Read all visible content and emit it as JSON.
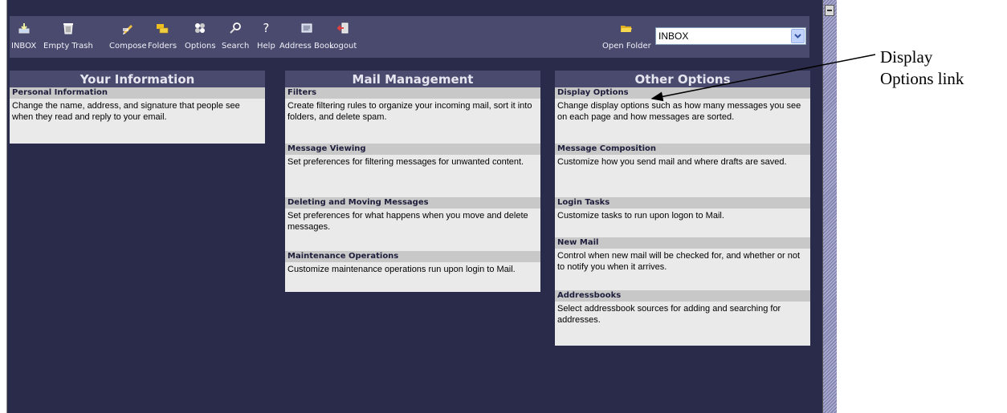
{
  "toolbar": {
    "items": [
      {
        "label": "INBOX",
        "icon": "inbox-tray-icon"
      },
      {
        "label": "Empty Trash",
        "icon": "trash-can-icon"
      },
      {
        "label": "Compose",
        "icon": "pencil-icon"
      },
      {
        "label": "Folders",
        "icon": "folders-icon"
      },
      {
        "label": "Options",
        "icon": "options-icon"
      },
      {
        "label": "Search",
        "icon": "magnifier-icon"
      },
      {
        "label": "Help",
        "icon": "question-mark-icon"
      },
      {
        "label": "Address Book",
        "icon": "address-book-icon"
      },
      {
        "label": "Logout",
        "icon": "logout-icon"
      }
    ],
    "open_folder_label": "Open Folder",
    "folder_select_value": "INBOX"
  },
  "columns": [
    {
      "heading": "Your Information",
      "sections": [
        {
          "title": "Personal Information",
          "desc": "Change the name, address, and signature that people see when they read and reply to your email."
        }
      ]
    },
    {
      "heading": "Mail Management",
      "sections": [
        {
          "title": "Filters",
          "desc": "Create filtering rules to organize your incoming mail, sort it into folders, and delete spam."
        },
        {
          "title": "Message Viewing",
          "desc": "Set preferences for filtering messages for unwanted content."
        },
        {
          "title": "Deleting and Moving Messages",
          "desc": "Set preferences for what happens when you move and delete messages."
        },
        {
          "title": "Maintenance Operations",
          "desc": "Customize maintenance operations run upon login to Mail."
        }
      ]
    },
    {
      "heading": "Other Options",
      "sections": [
        {
          "title": "Display Options",
          "desc": "Change display options such as how many messages you see on each page and how messages are sorted."
        },
        {
          "title": "Message Composition",
          "desc": "Customize how you send mail and where drafts are saved."
        },
        {
          "title": "Login Tasks",
          "desc": "Customize tasks to run upon logon to Mail."
        },
        {
          "title": "New Mail",
          "desc": "Control when new mail will be checked for, and whether or not to notify you when it arrives."
        },
        {
          "title": "Addressbooks",
          "desc": "Select addressbook sources for adding and searching for addresses."
        }
      ]
    }
  ],
  "annotation": {
    "line1": "Display",
    "line2": "Options link"
  },
  "colors": {
    "background": "#2a2a4a",
    "toolbar": "#4a4a6e",
    "section_title": "#c8c8c8",
    "section_body": "#eaeaea"
  }
}
